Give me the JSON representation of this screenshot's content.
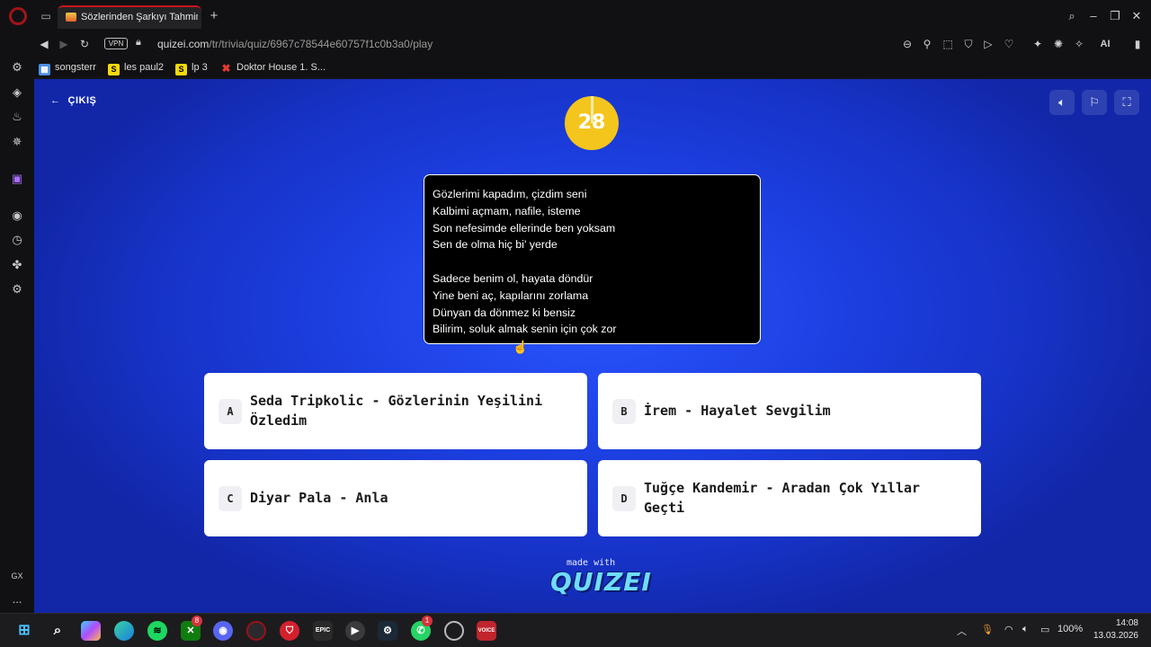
{
  "tab": {
    "title": "Sözlerinden Şarkıyı Tahmin"
  },
  "address": {
    "domain": "quizei.com",
    "path": "/tr/trivia/quiz/6967c78544e60757f1c0b3a0/play",
    "vpn": "VPN",
    "ai": "AI"
  },
  "bookmarks": [
    {
      "label": "songsterr",
      "icon": "S"
    },
    {
      "label": "les paul2",
      "icon": "S"
    },
    {
      "label": "lp 3",
      "icon": "S"
    },
    {
      "label": "Doktor House 1. S...",
      "icon": ""
    }
  ],
  "sidebar": {
    "gx": "GX",
    "more": "..."
  },
  "quiz": {
    "exit_label": "ÇIKIŞ",
    "timer": "28",
    "lyrics": [
      "Gözlerimi kapadım, çizdim seni",
      "Kalbimi açmam, nafile, isteme",
      "Son nefesimde ellerinde ben yoksam",
      "Sen de olma hiç bi' yerde",
      "Sadece benim ol, hayata döndür",
      "Yine beni aç, kapılarını zorlama",
      "Dünyan da dönmez ki bensiz",
      "Bilirim, soluk almak senin için çok zor"
    ],
    "answers": [
      {
        "key": "A",
        "text": "Seda Tripkolic - Gözlerinin Yeşilini Özledim"
      },
      {
        "key": "B",
        "text": "İrem - Hayalet Sevgilim"
      },
      {
        "key": "C",
        "text": "Diyar Pala - Anla"
      },
      {
        "key": "D",
        "text": "Tuğçe Kandemir - Aradan Çok Yıllar Geçti"
      }
    ],
    "made_with": "made with",
    "brand": "QUIZEI"
  },
  "taskbar": {
    "epic": "EPIC",
    "voicemeeter": "VOICE",
    "badge_xbox": "8",
    "badge_whatsapp": "1",
    "battery": "100%",
    "time": "14:08",
    "date": "13.03.2026"
  },
  "colors": {
    "accent": "#c8141c",
    "timer": "#f4c51c",
    "page_bg": "#1c3fe0"
  }
}
